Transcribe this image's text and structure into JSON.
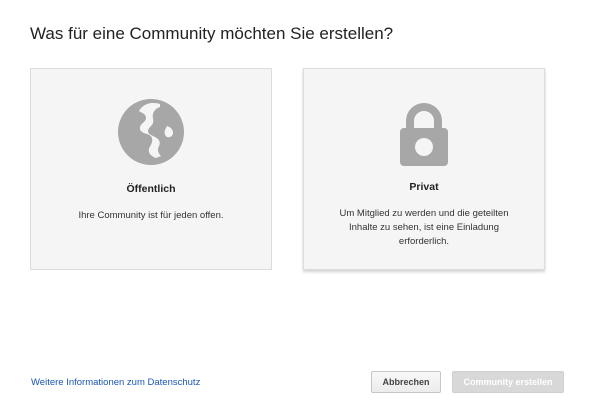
{
  "title": "Was für eine Community möchten Sie erstellen?",
  "options": [
    {
      "icon": "globe-icon",
      "title": "Öffentlich",
      "description": "Ihre Community ist für jeden offen."
    },
    {
      "icon": "lock-icon",
      "title": "Privat",
      "description": "Um Mitglied zu werden und die geteilten Inhalte zu sehen, ist eine Einladung erforderlich."
    }
  ],
  "footer": {
    "privacy_link": "Weitere Informationen zum Datenschutz",
    "cancel_label": "Abbrechen",
    "create_label": "Community erstellen"
  },
  "colors": {
    "icon": "#a7a7a7",
    "link": "#1a56b6",
    "card_bg": "#f5f5f5",
    "create_disabled": "#d8d8d8"
  }
}
